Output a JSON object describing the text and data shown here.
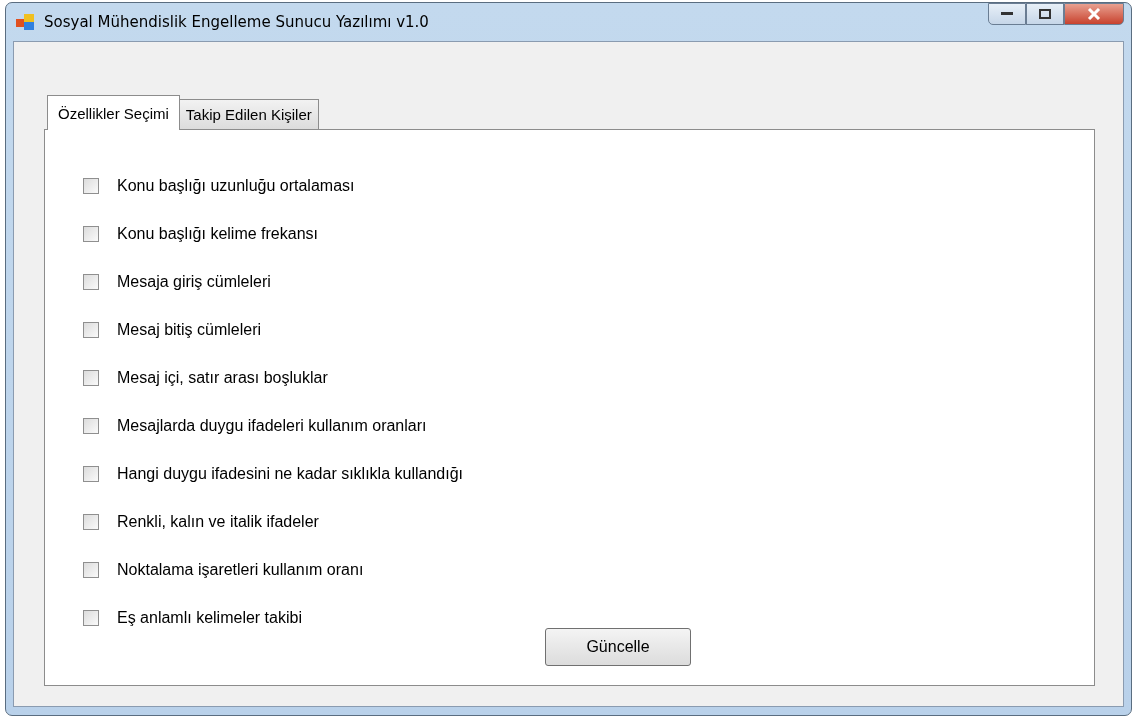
{
  "window": {
    "title": "Sosyal Mühendislik Engelleme Sunucu Yazılımı v1.0"
  },
  "tabs": [
    {
      "label": "Özellikler Seçimi",
      "selected": true
    },
    {
      "label": "Takip Edilen Kişiler",
      "selected": false
    }
  ],
  "options": [
    {
      "label": "Konu başlığı uzunluğu ortalaması",
      "checked": false
    },
    {
      "label": "Konu başlığı kelime frekansı",
      "checked": false
    },
    {
      "label": "Mesaja giriş cümleleri",
      "checked": false
    },
    {
      "label": "Mesaj bitiş cümleleri",
      "checked": false
    },
    {
      "label": "Mesaj içi, satır arası boşluklar",
      "checked": false
    },
    {
      "label": "Mesajlarda duygu ifadeleri kullanım oranları",
      "checked": false
    },
    {
      "label": "Hangi duygu ifadesini ne kadar sıklıkla kullandığı",
      "checked": false
    },
    {
      "label": "Renkli, kalın ve italik ifadeler",
      "checked": false
    },
    {
      "label": "Noktalama işaretleri kullanım oranı",
      "checked": false
    },
    {
      "label": "Eş anlamlı kelimeler takibi",
      "checked": false
    }
  ],
  "update_button": "Güncelle"
}
